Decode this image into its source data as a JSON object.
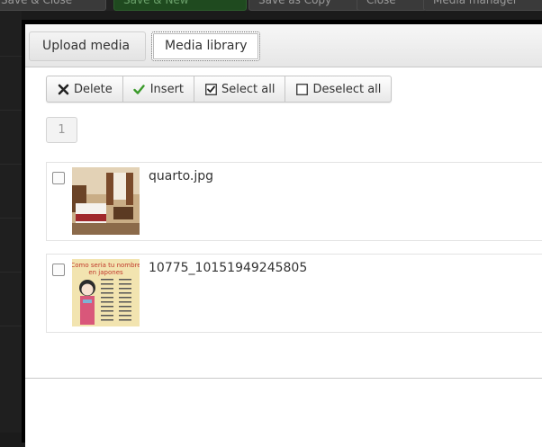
{
  "background_toolbar": {
    "buttons": [
      "Save & Close",
      "Save & New",
      "Save as Copy",
      "Close",
      "Media manager"
    ]
  },
  "modal": {
    "tabs": [
      {
        "label": "Upload media",
        "active": false
      },
      {
        "label": "Media library",
        "active": true
      }
    ],
    "toolbar": {
      "delete_label": "Delete",
      "insert_label": "Insert",
      "select_all_label": "Select all",
      "deselect_all_label": "Deselect all"
    },
    "pager": {
      "current_page": "1"
    },
    "items": [
      {
        "filename": "quarto.jpg",
        "checked": false,
        "thumb_icon": "hotel-room-photo"
      },
      {
        "filename": "10775_10151949245805",
        "checked": false,
        "thumb_icon": "japanese-name-poster"
      }
    ],
    "poster_text": {
      "title_line1": "Como seria tu nombre",
      "title_line2": "en japones"
    }
  },
  "colors": {
    "insert_check": "#3a9a2a",
    "poster_bg": "#f2e4b0",
    "poster_title": "#c0392b"
  }
}
